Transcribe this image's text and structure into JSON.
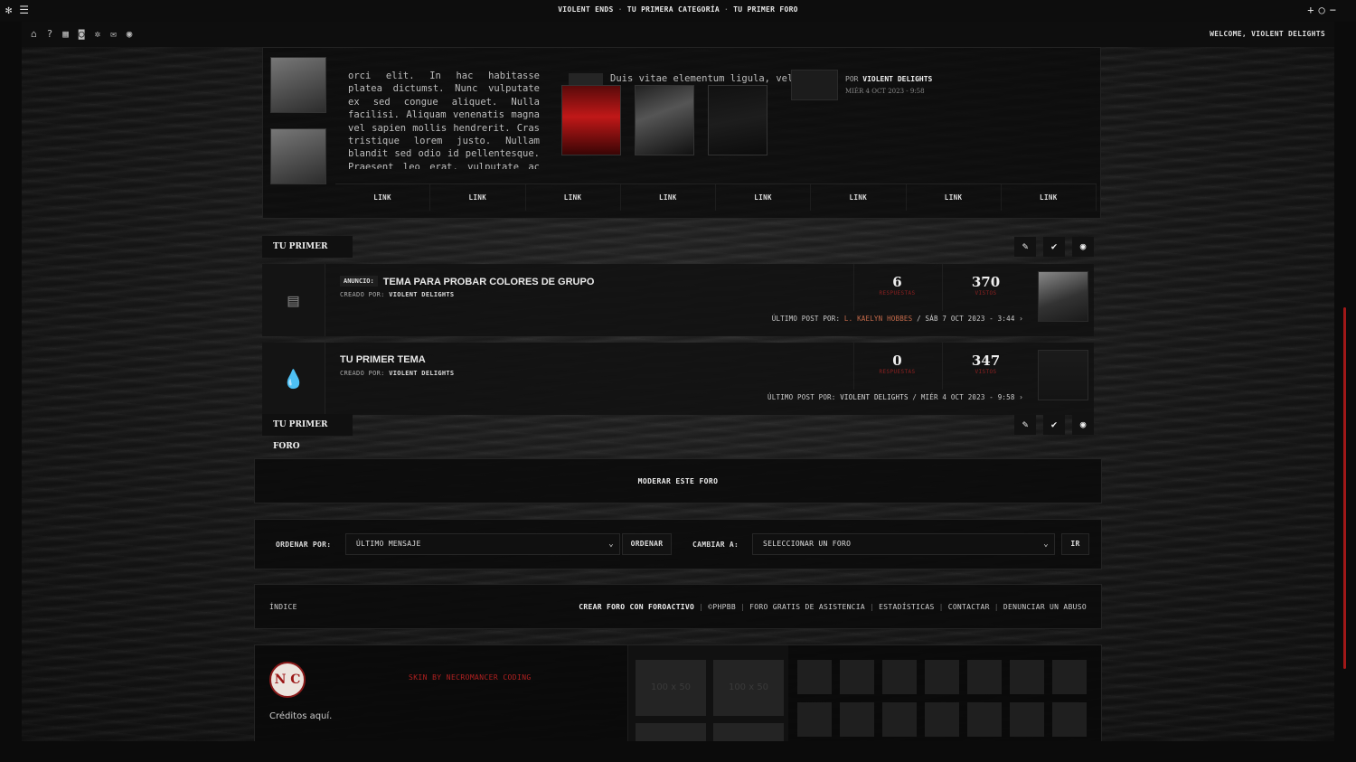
{
  "topbar": {
    "crumbs": [
      "VIOLENT ENDS",
      "TU PRIMERA CATEGORÍA",
      "TU PRIMER FORO"
    ],
    "separator": "·"
  },
  "navbar": {
    "icons": [
      "home-icon",
      "help-icon",
      "groups-icon",
      "members-icon",
      "settings-icon",
      "messages-icon",
      "profile-icon"
    ],
    "welcome": "WELCOME, VIOLENT DELIGHTS"
  },
  "widget": {
    "lorem": "orci elit. In hac habitasse platea dictumst. Nunc vulputate ex sed congue aliquet. Nulla facilisi. Aliquam venenatis magna vel sapien mollis hendrerit. Cras tristique lorem justo. Nullam blandit sed odio id pellentesque. Praesent leo erat, vulputate ac felis sit amet, hendrerit dapibus purus. Vestibulum ante ipsum primis in faucibus orci luctus et",
    "duis": "Duis vitae elementum ligula, vel",
    "author_prefix": "POR",
    "author_name": "VIOLENT DELIGHTS",
    "date": "MIÉR 4 OCT 2023 - 9:58",
    "links": [
      "LINK",
      "LINK",
      "LINK",
      "LINK",
      "LINK",
      "LINK",
      "LINK",
      "LINK"
    ]
  },
  "forum": {
    "header": "TU PRIMER FORO",
    "footer_header": "TU PRIMER FORO",
    "tools": [
      "pencil-icon",
      "check-icon",
      "eye-icon"
    ]
  },
  "topics": [
    {
      "badge": "ANUNCIO:",
      "title": "TEMA PARA PROBAR COLORES DE GRUPO",
      "created_label": "CREADO POR:",
      "created_by": "VIOLENT DELIGHTS",
      "replies": "6",
      "replies_label": "RESPUESTAS",
      "views": "370",
      "views_label": "VISTOS",
      "last_label": "ÚLTIMO POST POR:",
      "last_user": "L. KAELYN HOBBES",
      "last_date": "/ SÁB 7 OCT 2023 - 3:44",
      "arrow": "›"
    },
    {
      "badge": "",
      "title": "TU PRIMER TEMA",
      "created_label": "CREADO POR:",
      "created_by": "VIOLENT DELIGHTS",
      "replies": "0",
      "replies_label": "RESPUESTAS",
      "views": "347",
      "views_label": "VISTOS",
      "last_label": "ÚLTIMO POST POR:",
      "last_user": "VIOLENT DELIGHTS",
      "last_date": "/ MIÉR 4 OCT 2023 - 9:58",
      "arrow": "›"
    }
  ],
  "moderate": "MODERAR ESTE FORO",
  "sort": {
    "order_label": "ORDENAR POR:",
    "order_value": "ÚLTIMO MENSAJE",
    "order_button": "ORDENAR",
    "change_label": "CAMBIAR A:",
    "change_value": "SELECCIONAR UN FORO",
    "go_button": "IR"
  },
  "footer": {
    "index": "ÍNDICE",
    "links": [
      "CREAR FORO CON FOROACTIVO",
      "©PHPBB",
      "FORO GRATIS DE ASISTENCIA",
      "ESTADÍSTICAS",
      "CONTACTAR",
      "DENUNCIAR UN ABUSO"
    ],
    "separator": "|"
  },
  "credits": {
    "logo": "N C",
    "skin": "SKIN BY NECROMANCER CODING",
    "text": "Créditos aquí.",
    "ad_label": "100 x 50"
  },
  "colors": {
    "accent": "#b02020",
    "username": "#c46a4a",
    "background": "#1a1a1a"
  }
}
